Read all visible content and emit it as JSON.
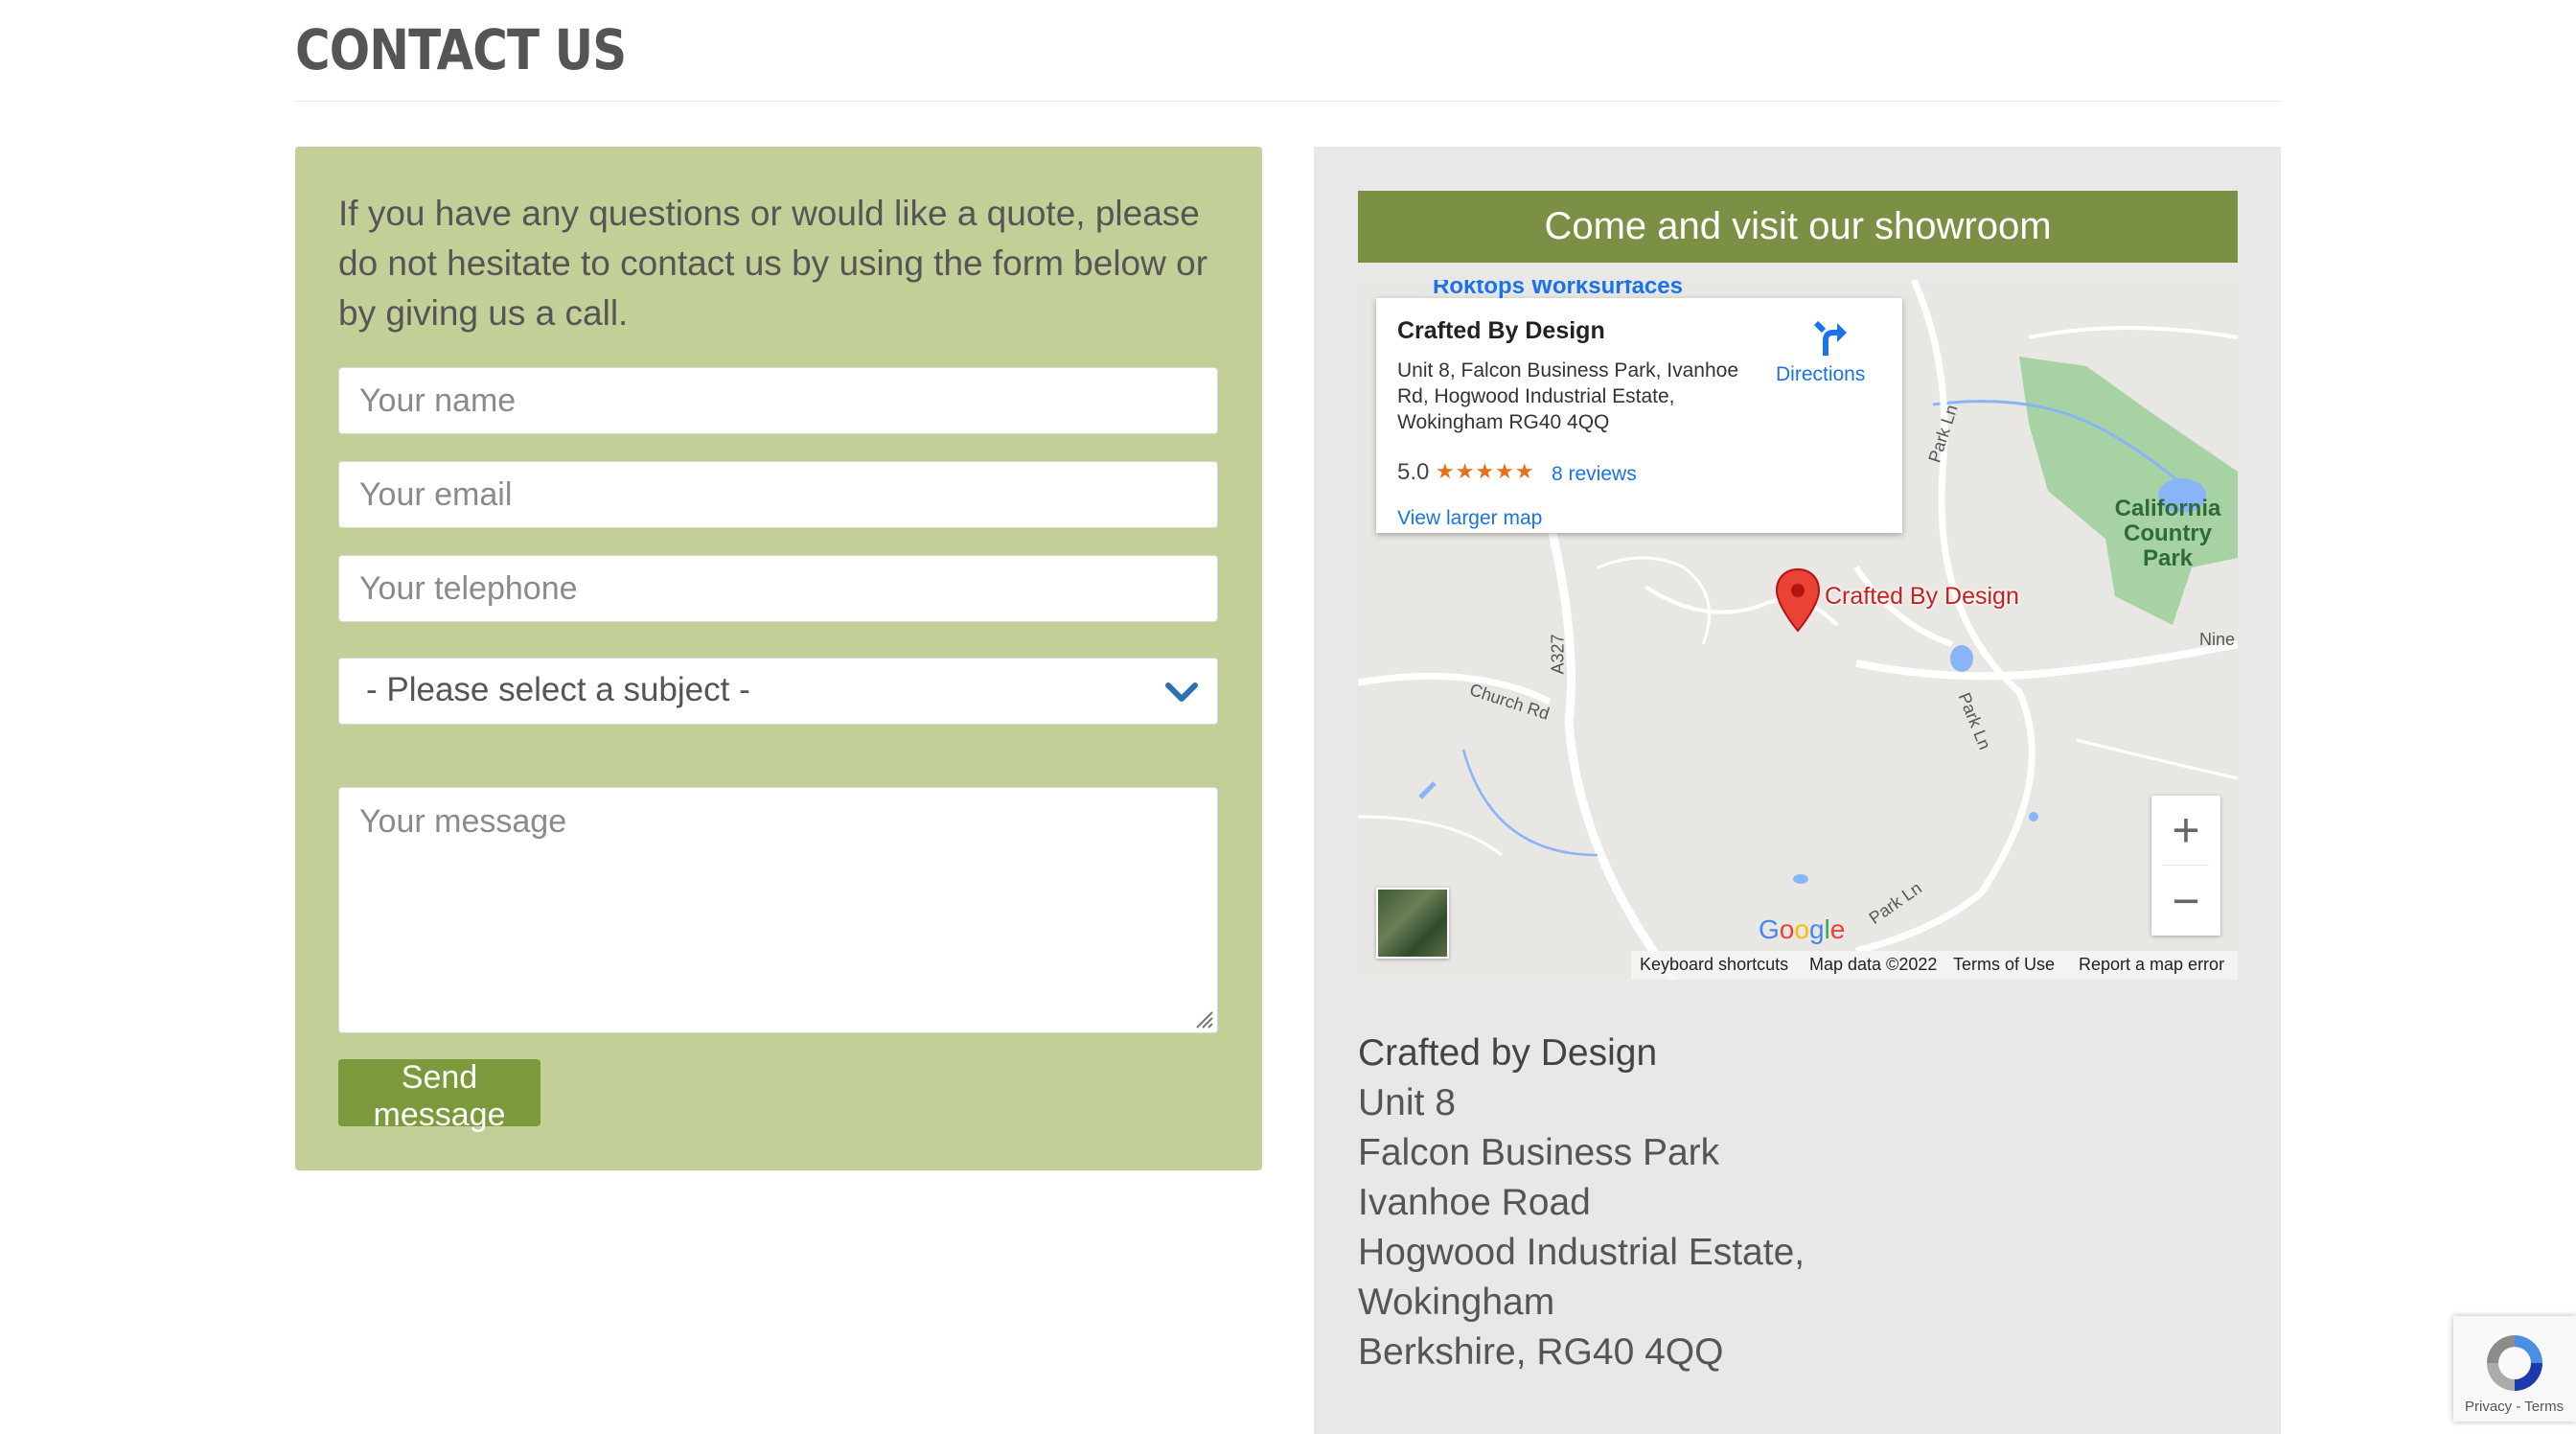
{
  "page": {
    "title": "CONTACT US"
  },
  "form": {
    "intro": "If you have any questions or would like a quote, please do not hesitate to contact us by using the form below or by giving us a call.",
    "name_placeholder": "Your name",
    "email_placeholder": "Your email",
    "telephone_placeholder": "Your telephone",
    "subject_selected": "- Please select a subject -",
    "message_placeholder": "Your message",
    "send_label": "Send message"
  },
  "showroom": {
    "header": "Come and visit our showroom",
    "map": {
      "place_name": "Crafted By Design",
      "place_address": "Unit 8, Falcon Business Park, Ivanhoe Rd, Hogwood Industrial Estate, Wokingham RG40 4QQ",
      "rating": "5.0",
      "stars": "★★★★★",
      "reviews": "8 reviews",
      "directions": "Directions",
      "view_larger": "View larger map",
      "pin_label": "Crafted By Design",
      "nearby_label": "Roktops Worksurfaces",
      "park_label_1": "California",
      "park_label_2": "Country Park",
      "roads": {
        "park_ln": "Park Ln",
        "a327": "A327",
        "church_rd": "Church Rd",
        "nine": "Nine"
      },
      "zoom_in": "+",
      "zoom_out": "−",
      "footer": {
        "shortcuts": "Keyboard shortcuts",
        "map_data": "Map data ©2022",
        "terms": "Terms of Use",
        "report": "Report a map error"
      }
    },
    "address": {
      "company": "Crafted by Design",
      "line1": "Unit 8",
      "line2": "Falcon Business Park",
      "line3": "Ivanhoe Road",
      "line4": "Hogwood Industrial Estate,",
      "line5": "Wokingham",
      "line6": "Berkshire, RG40 4QQ"
    }
  },
  "recaptcha": {
    "privacy": "Privacy",
    "sep": " - ",
    "terms": "Terms"
  },
  "colors": {
    "form_panel": "#c2d098",
    "button": "#7b9a3c",
    "header_bar": "#7b9045",
    "right_panel": "#e8e8e8"
  }
}
